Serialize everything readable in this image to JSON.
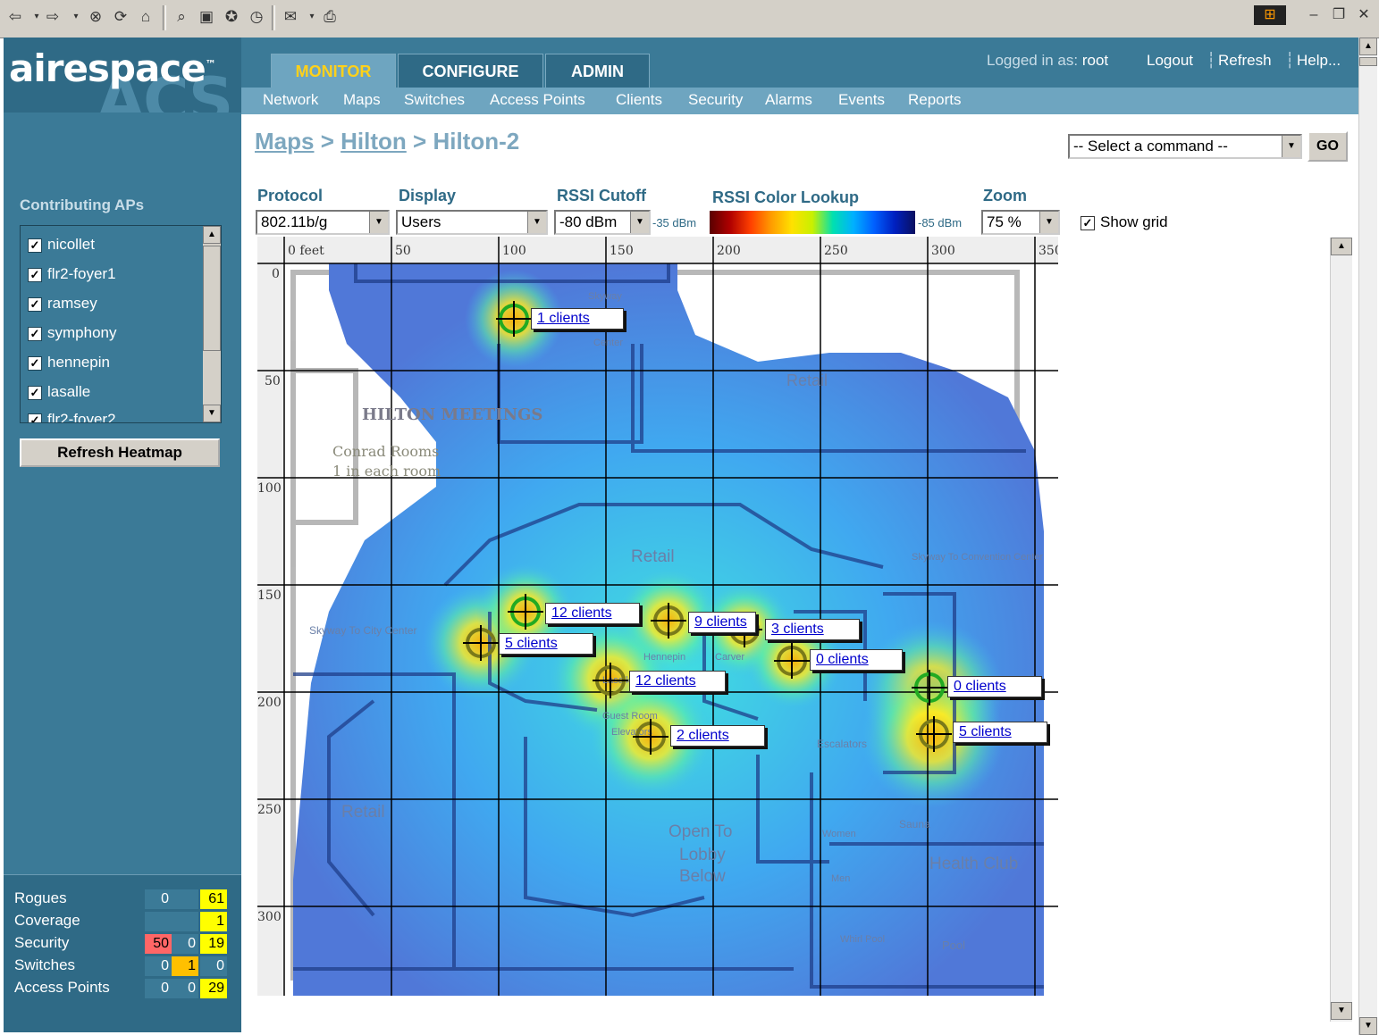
{
  "header": {
    "logo": "airespace",
    "logo_tm": "™",
    "logo_sub": "ACS",
    "tabs": [
      {
        "label": "MONITOR",
        "active": true
      },
      {
        "label": "CONFIGURE",
        "active": false
      },
      {
        "label": "ADMIN",
        "active": false
      }
    ],
    "subnav": [
      "Network",
      "Maps",
      "Switches",
      "Access Points",
      "Clients",
      "Security",
      "Alarms",
      "Events",
      "Reports"
    ],
    "logged_in_prefix": "Logged in as:",
    "logged_in_user": "root",
    "links": [
      "Logout",
      "Refresh",
      "Help..."
    ]
  },
  "breadcrumb": {
    "items": [
      "Maps",
      "Hilton",
      "Hilton-2"
    ],
    "separator": ">"
  },
  "command": {
    "placeholder": "-- Select a command --",
    "go_label": "GO"
  },
  "controls": {
    "protocol_label": "Protocol",
    "protocol_value": "802.11b/g",
    "display_label": "Display",
    "display_value": "Users",
    "rssi_cutoff_label": "RSSI Cutoff",
    "rssi_cutoff_value": "-80 dBm",
    "rssi_lookup_label": "RSSI Color Lookup",
    "rssi_min": "-35 dBm",
    "rssi_max": "-85 dBm",
    "zoom_label": "Zoom",
    "zoom_value": "75 %",
    "show_grid_label": "Show grid",
    "show_grid_checked": true
  },
  "sidebar": {
    "contributing_title": "Contributing APs",
    "aps": [
      {
        "name": "nicollet",
        "checked": true
      },
      {
        "name": "flr2-foyer1",
        "checked": true
      },
      {
        "name": "ramsey",
        "checked": true
      },
      {
        "name": "symphony",
        "checked": true
      },
      {
        "name": "hennepin",
        "checked": true
      },
      {
        "name": "lasalle",
        "checked": true
      },
      {
        "name": "flr2-foyer2",
        "checked": true
      }
    ],
    "refresh_label": "Refresh Heatmap"
  },
  "alarms": [
    {
      "label": "Rogues",
      "critical": "",
      "major": "0",
      "minor": "61"
    },
    {
      "label": "Coverage",
      "critical": "",
      "major": "",
      "minor": "1"
    },
    {
      "label": "Security",
      "critical": "50",
      "major": "0",
      "minor": "19"
    },
    {
      "label": "Switches",
      "critical": "",
      "major": "0",
      "minor": "1",
      "extra": "0"
    },
    {
      "label": "Access Points",
      "critical": "",
      "major": "0",
      "minor": "0",
      "extra": "29"
    }
  ],
  "map": {
    "x_ticks": [
      "0 feet",
      "50",
      "100",
      "150",
      "200",
      "250",
      "300",
      "350"
    ],
    "y_ticks": [
      "0",
      "50",
      "100",
      "150",
      "200",
      "250",
      "300"
    ],
    "floor_labels": [
      "Retail",
      "HILTON MEETINGS",
      "Conrad Rooms",
      "1 in each room",
      "Retail",
      "Skyway To City Center",
      "Skyway To Convention Center",
      "Retail",
      "Open To",
      "Lobby",
      "Below",
      "Health Club",
      "Escalators",
      "Women",
      "Men",
      "Sauna",
      "Pool",
      "Whirl Pool",
      "Hennepin",
      "Carver",
      "Lasalle",
      "Guest Room",
      "Elevators",
      "Skyway",
      "Center"
    ],
    "client_labels": [
      "1 clients",
      "12 clients",
      "5 clients",
      "9 clients",
      "3 clients",
      "0 clients",
      "12 clients",
      "0 clients",
      "2 clients",
      "5 clients"
    ]
  },
  "colors": {
    "sidebar": "#3b7a97",
    "tab_active_text": "#ffd11a",
    "ap_ok": "#22aa22",
    "ap_warn": "#7a7a1a"
  }
}
